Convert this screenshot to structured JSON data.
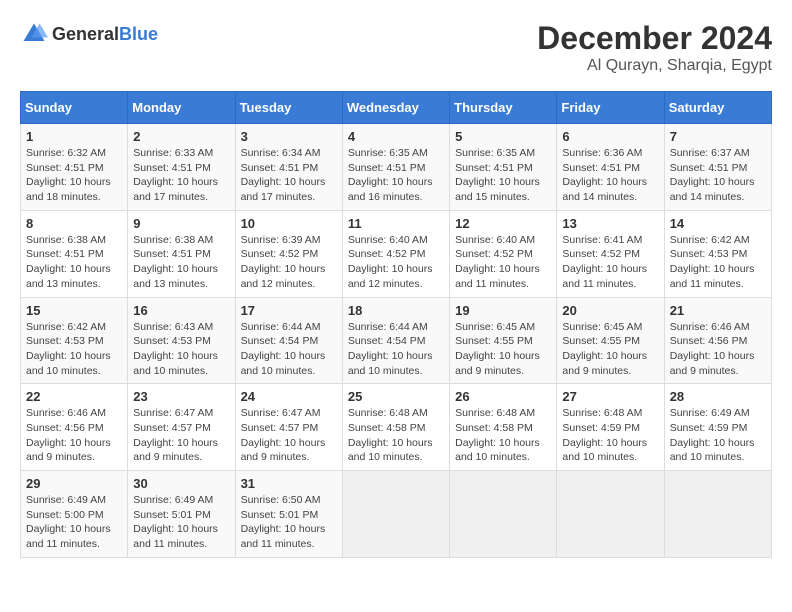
{
  "header": {
    "logo_general": "General",
    "logo_blue": "Blue",
    "title": "December 2024",
    "subtitle": "Al Qurayn, Sharqia, Egypt"
  },
  "calendar": {
    "days_of_week": [
      "Sunday",
      "Monday",
      "Tuesday",
      "Wednesday",
      "Thursday",
      "Friday",
      "Saturday"
    ],
    "weeks": [
      [
        {
          "day": "1",
          "sunrise": "6:32 AM",
          "sunset": "4:51 PM",
          "daylight": "10 hours and 18 minutes."
        },
        {
          "day": "2",
          "sunrise": "6:33 AM",
          "sunset": "4:51 PM",
          "daylight": "10 hours and 17 minutes."
        },
        {
          "day": "3",
          "sunrise": "6:34 AM",
          "sunset": "4:51 PM",
          "daylight": "10 hours and 17 minutes."
        },
        {
          "day": "4",
          "sunrise": "6:35 AM",
          "sunset": "4:51 PM",
          "daylight": "10 hours and 16 minutes."
        },
        {
          "day": "5",
          "sunrise": "6:35 AM",
          "sunset": "4:51 PM",
          "daylight": "10 hours and 15 minutes."
        },
        {
          "day": "6",
          "sunrise": "6:36 AM",
          "sunset": "4:51 PM",
          "daylight": "10 hours and 14 minutes."
        },
        {
          "day": "7",
          "sunrise": "6:37 AM",
          "sunset": "4:51 PM",
          "daylight": "10 hours and 14 minutes."
        }
      ],
      [
        {
          "day": "8",
          "sunrise": "6:38 AM",
          "sunset": "4:51 PM",
          "daylight": "10 hours and 13 minutes."
        },
        {
          "day": "9",
          "sunrise": "6:38 AM",
          "sunset": "4:51 PM",
          "daylight": "10 hours and 13 minutes."
        },
        {
          "day": "10",
          "sunrise": "6:39 AM",
          "sunset": "4:52 PM",
          "daylight": "10 hours and 12 minutes."
        },
        {
          "day": "11",
          "sunrise": "6:40 AM",
          "sunset": "4:52 PM",
          "daylight": "10 hours and 12 minutes."
        },
        {
          "day": "12",
          "sunrise": "6:40 AM",
          "sunset": "4:52 PM",
          "daylight": "10 hours and 11 minutes."
        },
        {
          "day": "13",
          "sunrise": "6:41 AM",
          "sunset": "4:52 PM",
          "daylight": "10 hours and 11 minutes."
        },
        {
          "day": "14",
          "sunrise": "6:42 AM",
          "sunset": "4:53 PM",
          "daylight": "10 hours and 11 minutes."
        }
      ],
      [
        {
          "day": "15",
          "sunrise": "6:42 AM",
          "sunset": "4:53 PM",
          "daylight": "10 hours and 10 minutes."
        },
        {
          "day": "16",
          "sunrise": "6:43 AM",
          "sunset": "4:53 PM",
          "daylight": "10 hours and 10 minutes."
        },
        {
          "day": "17",
          "sunrise": "6:44 AM",
          "sunset": "4:54 PM",
          "daylight": "10 hours and 10 minutes."
        },
        {
          "day": "18",
          "sunrise": "6:44 AM",
          "sunset": "4:54 PM",
          "daylight": "10 hours and 10 minutes."
        },
        {
          "day": "19",
          "sunrise": "6:45 AM",
          "sunset": "4:55 PM",
          "daylight": "10 hours and 9 minutes."
        },
        {
          "day": "20",
          "sunrise": "6:45 AM",
          "sunset": "4:55 PM",
          "daylight": "10 hours and 9 minutes."
        },
        {
          "day": "21",
          "sunrise": "6:46 AM",
          "sunset": "4:56 PM",
          "daylight": "10 hours and 9 minutes."
        }
      ],
      [
        {
          "day": "22",
          "sunrise": "6:46 AM",
          "sunset": "4:56 PM",
          "daylight": "10 hours and 9 minutes."
        },
        {
          "day": "23",
          "sunrise": "6:47 AM",
          "sunset": "4:57 PM",
          "daylight": "10 hours and 9 minutes."
        },
        {
          "day": "24",
          "sunrise": "6:47 AM",
          "sunset": "4:57 PM",
          "daylight": "10 hours and 9 minutes."
        },
        {
          "day": "25",
          "sunrise": "6:48 AM",
          "sunset": "4:58 PM",
          "daylight": "10 hours and 10 minutes."
        },
        {
          "day": "26",
          "sunrise": "6:48 AM",
          "sunset": "4:58 PM",
          "daylight": "10 hours and 10 minutes."
        },
        {
          "day": "27",
          "sunrise": "6:48 AM",
          "sunset": "4:59 PM",
          "daylight": "10 hours and 10 minutes."
        },
        {
          "day": "28",
          "sunrise": "6:49 AM",
          "sunset": "4:59 PM",
          "daylight": "10 hours and 10 minutes."
        }
      ],
      [
        {
          "day": "29",
          "sunrise": "6:49 AM",
          "sunset": "5:00 PM",
          "daylight": "10 hours and 11 minutes."
        },
        {
          "day": "30",
          "sunrise": "6:49 AM",
          "sunset": "5:01 PM",
          "daylight": "10 hours and 11 minutes."
        },
        {
          "day": "31",
          "sunrise": "6:50 AM",
          "sunset": "5:01 PM",
          "daylight": "10 hours and 11 minutes."
        },
        null,
        null,
        null,
        null
      ]
    ]
  }
}
